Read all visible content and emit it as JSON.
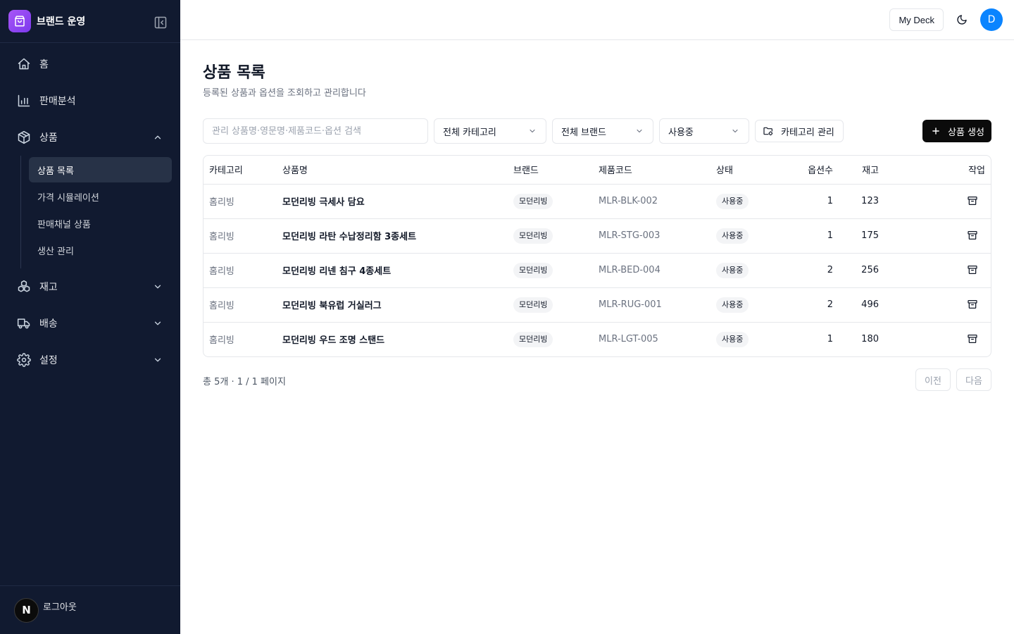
{
  "brand": {
    "name": "브랜드 운영"
  },
  "sidebar": {
    "items": [
      {
        "label": "홈",
        "icon": "home-icon"
      },
      {
        "label": "판매분석",
        "icon": "bar-chart-icon"
      },
      {
        "label": "상품",
        "icon": "package-icon",
        "expanded": true
      },
      {
        "label": "재고",
        "icon": "boxes-icon",
        "expanded": false
      },
      {
        "label": "배송",
        "icon": "truck-icon",
        "expanded": false
      },
      {
        "label": "설정",
        "icon": "gear-icon",
        "expanded": false
      }
    ],
    "product_sub": [
      {
        "label": "상품 목록",
        "active": true
      },
      {
        "label": "가격 시뮬레이션"
      },
      {
        "label": "판매채널 상품"
      },
      {
        "label": "생산 관리"
      }
    ],
    "footer": {
      "avatar": "N",
      "label": "로그아웃"
    }
  },
  "header": {
    "deck_label": "My Deck",
    "avatar_initial": "D"
  },
  "page": {
    "title": "상품 목록",
    "subtitle": "등록된 상품과 옵션을 조회하고 관리합니다"
  },
  "toolbar": {
    "search_placeholder": "관리 상품명·영문명·제품코드·옵션 검색",
    "category_select": "전체 카테고리",
    "brand_select": "전체 브랜드",
    "status_select": "사용중",
    "category_manage": "카테고리 관리",
    "create": "상품 생성"
  },
  "table": {
    "columns": [
      "카테고리",
      "상품명",
      "브랜드",
      "제품코드",
      "상태",
      "옵션수",
      "재고",
      "작업"
    ],
    "rows": [
      {
        "category": "홈리빙",
        "name": "모던리빙 극세사 담요",
        "brand": "모던리빙",
        "code": "MLR-BLK-002",
        "status": "사용중",
        "options": "1",
        "stock": "123"
      },
      {
        "category": "홈리빙",
        "name": "모던리빙 라탄 수납정리함 3종세트",
        "brand": "모던리빙",
        "code": "MLR-STG-003",
        "status": "사용중",
        "options": "1",
        "stock": "175"
      },
      {
        "category": "홈리빙",
        "name": "모던리빙 리넨 침구 4종세트",
        "brand": "모던리빙",
        "code": "MLR-BED-004",
        "status": "사용중",
        "options": "2",
        "stock": "256"
      },
      {
        "category": "홈리빙",
        "name": "모던리빙 북유럽 거실러그",
        "brand": "모던리빙",
        "code": "MLR-RUG-001",
        "status": "사용중",
        "options": "2",
        "stock": "496"
      },
      {
        "category": "홈리빙",
        "name": "모던리빙 우드 조명 스탠드",
        "brand": "모던리빙",
        "code": "MLR-LGT-005",
        "status": "사용중",
        "options": "1",
        "stock": "180"
      }
    ]
  },
  "pagination": {
    "info": "총 5개 · 1 / 1 페이지",
    "prev": "이전",
    "next": "다음"
  },
  "colors": {
    "sidebar_bg": "#111a30",
    "brand_accent": "#8b5cf6",
    "primary_button": "#0b0b0b",
    "avatar": "#0a84ff"
  }
}
